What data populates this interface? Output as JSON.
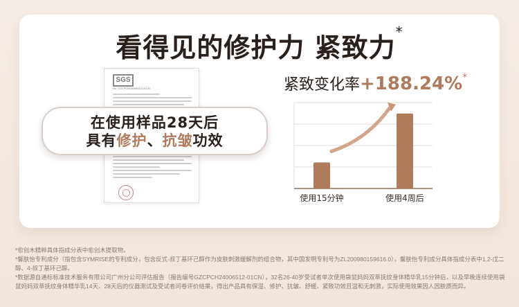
{
  "title": "看得见的修护力 紧致力",
  "title_sup": "*",
  "report": {
    "logo": "SGS",
    "ref": "No. GZCPCH24006512-01CN"
  },
  "callout": {
    "line1": "在使用样品28天后",
    "line2_pre": "具有",
    "line2_hl1": "修护",
    "line2_sep": "、",
    "line2_hl2": "抗皱",
    "line2_post": "功效"
  },
  "chart_data": {
    "type": "bar",
    "title": "紧致变化率",
    "highlight": "+188.24%",
    "highlight_sup": "*",
    "categories": [
      "使用15分钟",
      "使用4周后"
    ],
    "values": [
      1.0,
      2.8824
    ],
    "colors": {
      "bar": "#b07a5c",
      "grid": "#e5dcd7",
      "arrow": "#c99677"
    },
    "ylim": [
      0,
      3.3
    ],
    "grid": true
  },
  "footnotes": [
    "*愈创木精粹具体指成分表中愈创木提取物。",
    "*馨肤怡专利成分（指包含SYMRISE的专利成分，包含反式-叔丁基环己醇作为皮肤刺激缓解剂的组合物，其中国发明专利号为ZL200980159616.0），馨肤怡专利成分具体指成分表中1,2-戊二醇、4-叔丁基环己醇。",
    "*数据源自通标标准技术服务有限公司广州分公司评估报告（报告编号GZCPCH24006512-01CN），32名26-40岁受试者单次使用袋鼠妈妈双萃抚纹身体精华乳15分钟后，以及早晚连续使用袋鼠妈妈双萃抚纹身体精华乳14天、28天后的仪器测试及受试者问卷评价结果，得出产品具有保湿、修护、抗皱、舒缓、紧致功效且温和无刺激，实际使用效果因人因肤质而异。"
  ]
}
